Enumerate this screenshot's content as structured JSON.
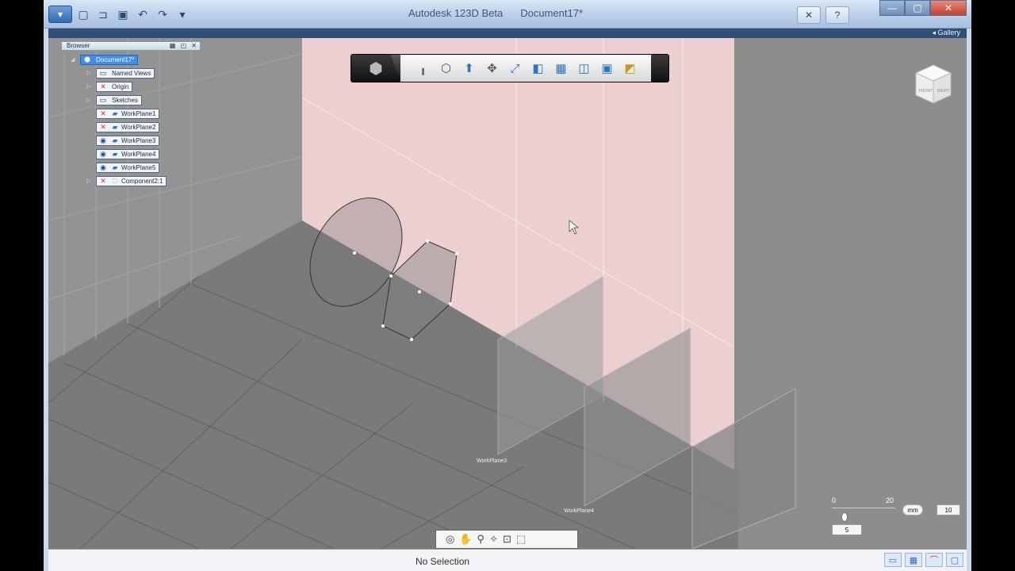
{
  "window": {
    "app_name": "Autodesk 123D Beta",
    "document_title": "Document17*"
  },
  "quick_access": {
    "items": [
      "app-menu",
      "new-icon",
      "open-icon",
      "save-icon",
      "undo-icon",
      "redo-icon",
      "dropdown-icon"
    ]
  },
  "help": {
    "sign_in_icon": "user-icon",
    "help_icon": "question-icon"
  },
  "window_controls": [
    "minimize",
    "maximize",
    "close"
  ],
  "gallery": {
    "label": "Gallery"
  },
  "browser": {
    "title": "Browser",
    "root": {
      "label": "Document17*",
      "selected": true
    },
    "items": [
      {
        "label": "Named Views",
        "icon": "folder-icon",
        "expandable": true
      },
      {
        "label": "Origin",
        "icon": "hidden-eye-icon",
        "expandable": true
      },
      {
        "label": "Sketches",
        "icon": "folder-icon",
        "expandable": true
      },
      {
        "label": "WorkPlane1",
        "icon": "hidden-eye-icon",
        "expandable": false
      },
      {
        "label": "WorkPlane2",
        "icon": "hidden-eye-icon",
        "expandable": false
      },
      {
        "label": "WorkPlane3",
        "icon": "eye-icon",
        "expandable": false
      },
      {
        "label": "WorkPlane4",
        "icon": "eye-icon",
        "expandable": false
      },
      {
        "label": "WorkPlane5",
        "icon": "eye-icon",
        "expandable": false
      },
      {
        "label": "Component2:1",
        "icon": "hidden-eye-icon",
        "expandable": true
      }
    ]
  },
  "toolbar": {
    "tools": [
      "home-icon",
      "primitives-icon",
      "sketch-icon",
      "construct-icon",
      "modify-icon",
      "pattern-icon",
      "group-icon",
      "combine-icon",
      "measure-icon",
      "text-icon",
      "material-icon"
    ]
  },
  "viewport": {
    "workplane_labels": [
      "WorkPlane3",
      "WorkPlane4"
    ],
    "viewcube_faces": [
      "FRONT",
      "RIGHT"
    ]
  },
  "ruler": {
    "tick_min": "0",
    "tick_max": "20",
    "unit": "mm",
    "value_box": "10",
    "knob_value": "5"
  },
  "navbar": {
    "tools": [
      "orbit-icon",
      "pan-icon",
      "zoom-icon",
      "look-icon",
      "fit-icon",
      "view-icon"
    ]
  },
  "status": {
    "message": "No Selection"
  },
  "colors": {
    "viewport_bg": "#8c8c8c",
    "workplane_pink": "#f4d6d6",
    "selection_blue": "#3f8ee8",
    "titlebar": "#b7cde6"
  }
}
